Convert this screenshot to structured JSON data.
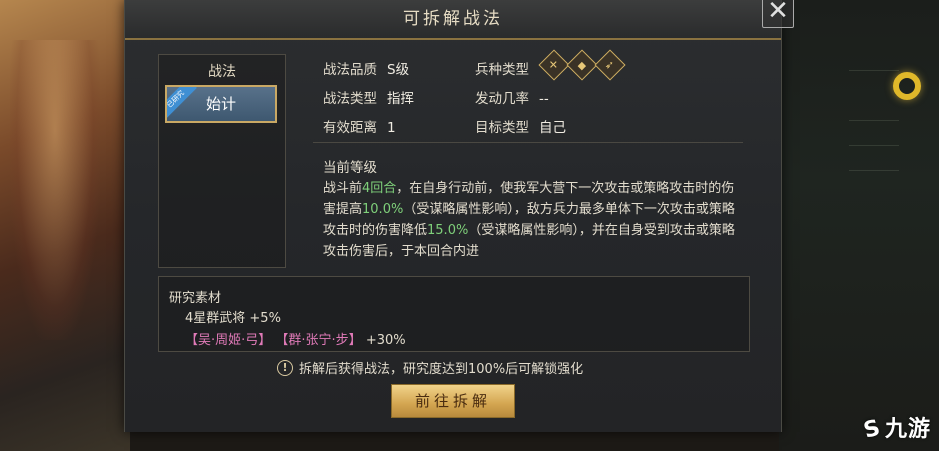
{
  "dialog": {
    "title": "可拆解战法",
    "close_glyph": "✕"
  },
  "tactic_list": {
    "header": "战法",
    "items": [
      {
        "name": "始计",
        "ribbon": "已研究"
      }
    ]
  },
  "info": {
    "quality_label": "战法品质",
    "quality_value": "S级",
    "type_label": "战法类型",
    "type_value": "指挥",
    "range_label": "有效距离",
    "range_value": "1",
    "troop_label": "兵种类型",
    "troop_icons": [
      "cavalry-icon",
      "shield-icon",
      "archer-icon"
    ],
    "rate_label": "发动几率",
    "rate_value": "--",
    "target_label": "目标类型",
    "target_value": "自己"
  },
  "description": {
    "title": "当前等级",
    "p1": "战斗前",
    "h1": "4回合",
    "p2": "，在自身行动前，使我军大营下一次攻击或策略攻击时的伤害提高",
    "h2": "10.0%",
    "p3": "（受谋略属性影响），敌方兵力最多单体下一次攻击或策略攻击时的伤害降低",
    "h3": "15.0%",
    "p4": "（受谋略属性影响），并在自身受到攻击或策略攻击伤害后，于本回合内进"
  },
  "research": {
    "title": "研究素材",
    "line1": "4星群武将 +5%",
    "mat1": "【吴·周姬·弓】",
    "mat2": "【群·张宁·步】",
    "bonus": "+30%"
  },
  "notice": "拆解后获得战法，研究度达到100%后可解锁强化",
  "action_button": "前往拆解",
  "watermark": "九游",
  "colors": {
    "highlight_green": "#7fd07a",
    "material_pink": "#e07ab8",
    "button_gold": "#d3a550",
    "selected_blue": "#4e6a84"
  }
}
